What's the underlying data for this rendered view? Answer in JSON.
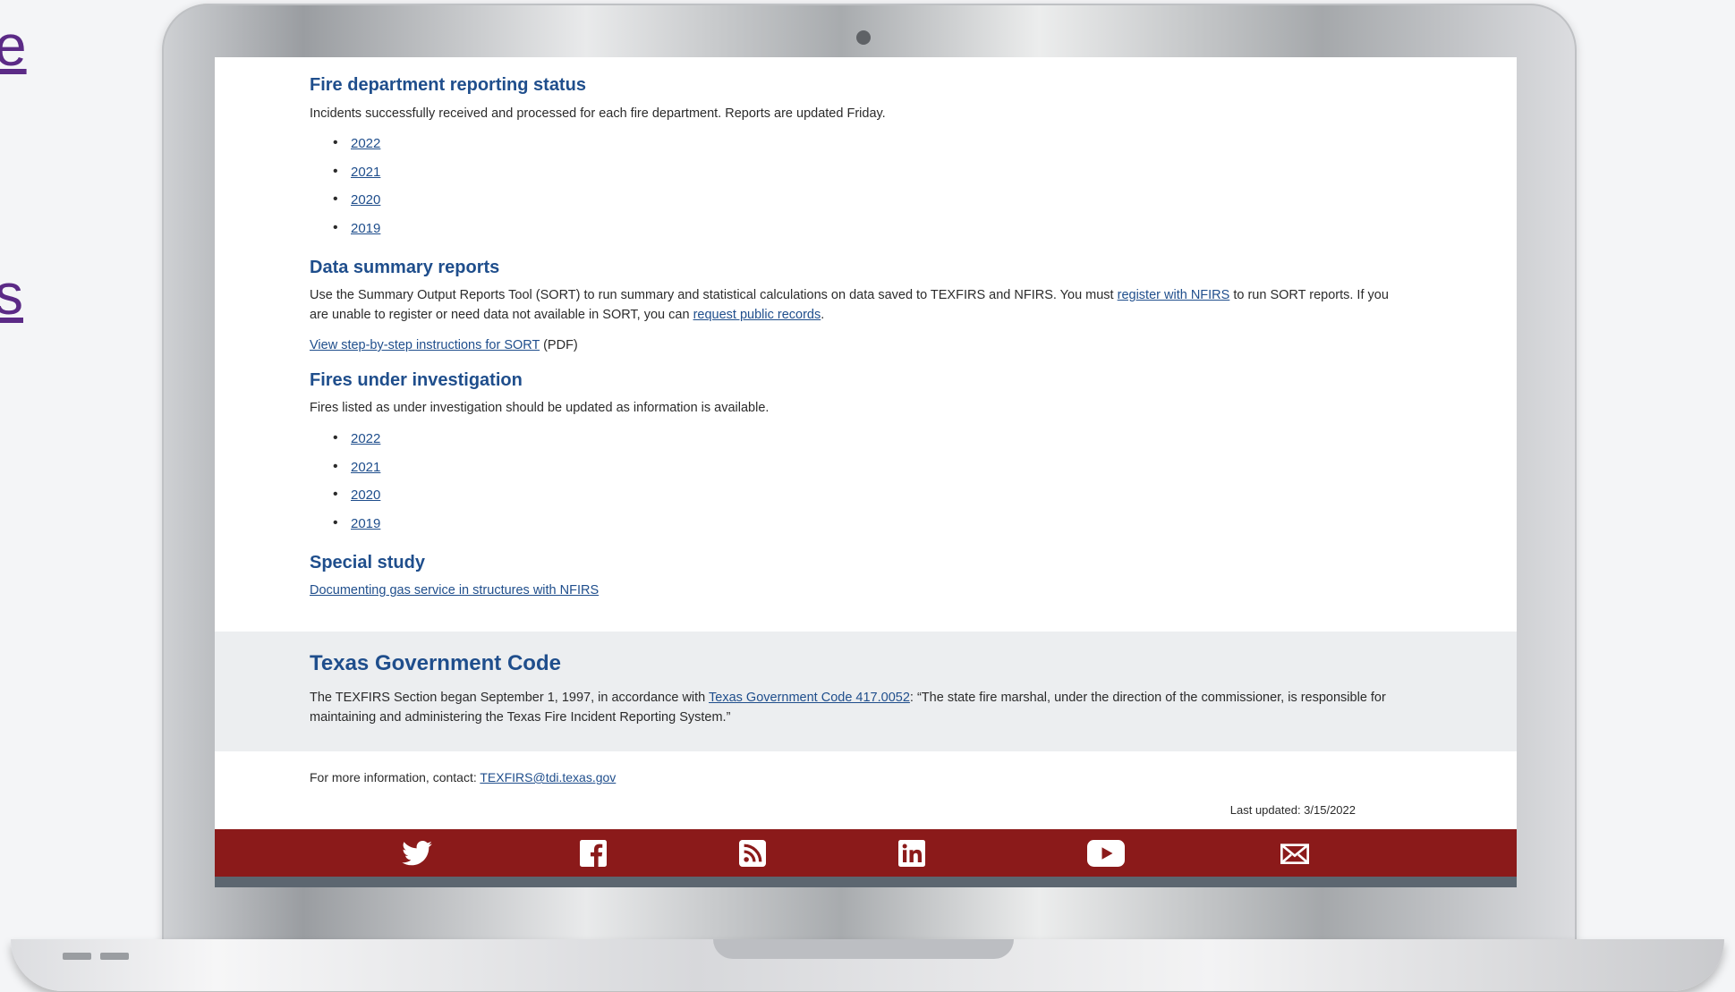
{
  "edge_letters": [
    "e",
    "s"
  ],
  "sections": {
    "reporting": {
      "title": "Fire department reporting status",
      "desc": "Incidents successfully received and processed for each fire department. Reports are updated Friday.",
      "years": [
        "2022",
        "2021",
        "2020",
        "2019"
      ]
    },
    "summary": {
      "title": "Data summary reports",
      "text1": "Use the Summary Output Reports Tool (SORT) to run summary and statistical calculations on data saved to TEXFIRS and NFIRS. You must ",
      "link1": "register with NFIRS",
      "text2": " to run SORT reports. If you are unable to register or need data not available in SORT, you can ",
      "link2": "request public records",
      "text3": ".",
      "instructions_link": "View step-by-step instructions for SORT",
      "instructions_suffix": " (PDF)"
    },
    "investigation": {
      "title": "Fires under investigation",
      "desc": "Fires listed as under investigation should be updated as information is available.",
      "years": [
        "2022",
        "2021",
        "2020",
        "2019"
      ]
    },
    "special": {
      "title": "Special study",
      "link": "Documenting gas service in structures with NFIRS"
    }
  },
  "gov_code": {
    "title": "Texas Government Code",
    "text1": "The TEXFIRS Section began September 1, 1997, in accordance with ",
    "link": "Texas Government Code 417.0052",
    "text2": ": “The state fire marshal, under the direction of the commissioner, is responsible for maintaining and administering the Texas Fire Incident Reporting System.”"
  },
  "footer": {
    "contact_label": "For more information, contact: ",
    "contact_email": "TEXFIRS@tdi.texas.gov",
    "last_updated": "Last updated: 3/15/2022"
  },
  "social_icons": [
    "twitter-icon",
    "facebook-icon",
    "rss-icon",
    "linkedin-icon",
    "youtube-icon",
    "email-icon"
  ],
  "colors": {
    "heading": "#1f4e8c",
    "social_bar": "#8b1a1a",
    "gray_band": "#eceef0"
  }
}
